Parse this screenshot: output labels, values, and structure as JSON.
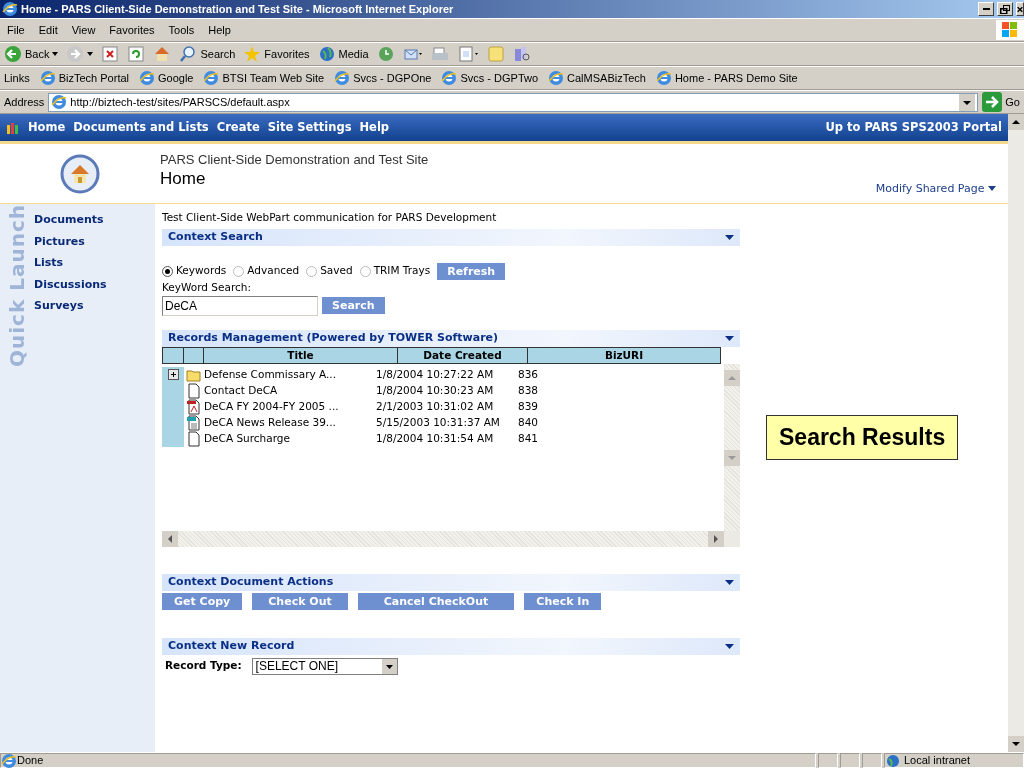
{
  "window": {
    "title": "Home - PARS Client-Side Demonstration and Test Site - Microsoft Internet Explorer"
  },
  "menu": [
    "File",
    "Edit",
    "View",
    "Favorites",
    "Tools",
    "Help"
  ],
  "toolbar": [
    {
      "kind": "back",
      "label": "Back"
    },
    {
      "kind": "forward"
    },
    {
      "kind": "stop"
    },
    {
      "kind": "refresh"
    },
    {
      "kind": "home"
    },
    {
      "kind": "search",
      "label": "Search"
    },
    {
      "kind": "favorites",
      "label": "Favorites"
    },
    {
      "kind": "media",
      "label": "Media"
    },
    {
      "kind": "history"
    },
    {
      "kind": "mail"
    },
    {
      "kind": "print"
    },
    {
      "kind": "edit"
    },
    {
      "kind": "discuss"
    },
    {
      "kind": "research"
    }
  ],
  "links": {
    "label": "Links",
    "items": [
      "BizTech Portal",
      "Google",
      "BTSI Team Web Site",
      "Svcs - DGPOne",
      "Svcs - DGPTwo",
      "CalMSABizTech",
      "Home - PARS Demo Site"
    ]
  },
  "address": {
    "label": "Address",
    "url": "http://biztech-test/sites/PARSCS/default.aspx",
    "go": "Go"
  },
  "top_nav": {
    "items": [
      "Home",
      "Documents and Lists",
      "Create",
      "Site Settings",
      "Help"
    ],
    "portal_link": "Up to PARS SPS2003 Portal"
  },
  "header": {
    "site_title": "PARS Client-Side Demonstration and Test Site",
    "page_title": "Home",
    "modify_link": "Modify Shared Page"
  },
  "quick_launch": {
    "label": "Quick Launch",
    "items": [
      "Documents",
      "Pictures",
      "Lists",
      "Discussions",
      "Surveys"
    ]
  },
  "description": "Test Client-Side WebPart communication for PARS Development",
  "context_search": {
    "title": "Context Search",
    "options": [
      {
        "label": "Keywords",
        "selected": true
      },
      {
        "label": "Advanced",
        "selected": false
      },
      {
        "label": "Saved",
        "selected": false
      },
      {
        "label": "TRIM Trays",
        "selected": false
      }
    ],
    "refresh": "Refresh",
    "keyword_label": "KeyWord Search:",
    "keyword_value": "DeCA",
    "search": "Search"
  },
  "records": {
    "title": "Records Management (Powered by TOWER Software)",
    "columns": [
      "Title",
      "Date Created",
      "BizURI"
    ],
    "rows": [
      {
        "expandable": true,
        "kind": "folder",
        "title": "Defense Commissary A...",
        "date": "1/8/2004 10:27:22 AM",
        "biz_uri": "836"
      },
      {
        "expandable": false,
        "kind": "document",
        "title": "Contact DeCA",
        "date": "1/8/2004 10:30:23 AM",
        "biz_uri": "838"
      },
      {
        "expandable": false,
        "kind": "pdf",
        "title": "DeCA FY 2004-FY 2005 ...",
        "date": "2/1/2003 10:31:02 AM",
        "biz_uri": "839"
      },
      {
        "expandable": false,
        "kind": "webpage",
        "title": "DeCA News Release 39...",
        "date": "5/15/2003 10:31:37 AM",
        "biz_uri": "840"
      },
      {
        "expandable": false,
        "kind": "document",
        "title": "DeCA Surcharge",
        "date": "1/8/2004 10:31:54 AM",
        "biz_uri": "841"
      }
    ]
  },
  "document_actions": {
    "title": "Context Document Actions",
    "buttons": [
      "Get Copy",
      "Check Out",
      "Cancel CheckOut",
      "Check In"
    ]
  },
  "new_record": {
    "title": "Context New Record",
    "label": "Record Type:",
    "value": "[SELECT ONE]"
  },
  "callout": "Search Results",
  "status_bar": {
    "text": "Done",
    "zone": "Local intranet"
  }
}
